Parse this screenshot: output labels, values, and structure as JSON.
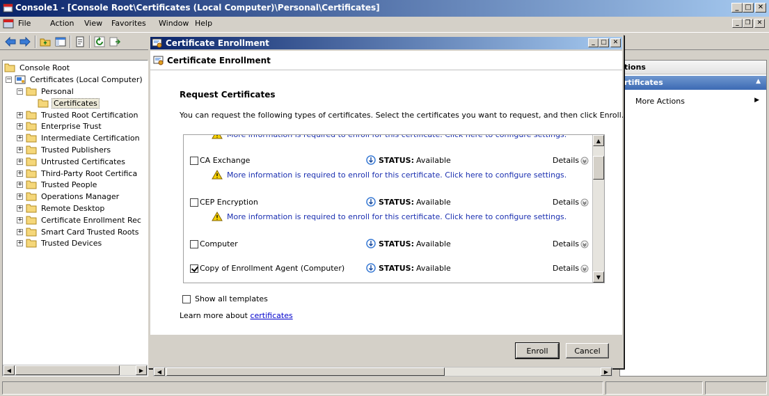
{
  "window": {
    "title": "Console1 - [Console Root\\Certificates (Local Computer)\\Personal\\Certificates]"
  },
  "menu": [
    "File",
    "Action",
    "View",
    "Favorites",
    "Window",
    "Help"
  ],
  "tree": {
    "root": "Console Root",
    "computer": "Certificates (Local Computer)",
    "personal": "Personal",
    "selected": "Certificates",
    "stores": [
      "Trusted Root Certification",
      "Enterprise Trust",
      "Intermediate Certification",
      "Trusted Publishers",
      "Untrusted Certificates",
      "Third-Party Root Certifica",
      "Trusted People",
      "Operations Manager",
      "Remote Desktop",
      "Certificate Enrollment Rec",
      "Smart Card Trusted Roots",
      "Trusted Devices"
    ]
  },
  "actions": {
    "header": "tions",
    "section": "rtificates",
    "more": "More Actions"
  },
  "dialog": {
    "title": "Certificate Enrollment",
    "header": "Certificate Enrollment",
    "heading": "Request Certificates",
    "intro": "You can request the following types of certificates. Select the certificates you want to request, and then click Enroll.",
    "status_label": "STATUS:",
    "details_label": "Details",
    "warning": "More information is required to enroll for this certificate. Click here to configure settings.",
    "certificates": [
      {
        "name": "CA Exchange",
        "status": "Available",
        "checked": false,
        "warning": true
      },
      {
        "name": "CEP Encryption",
        "status": "Available",
        "checked": false,
        "warning": true
      },
      {
        "name": "Computer",
        "status": "Available",
        "checked": false,
        "warning": false
      },
      {
        "name": "Copy of Enrollment Agent (Computer)",
        "status": "Available",
        "checked": true,
        "warning": false
      }
    ],
    "show_all": "Show all templates",
    "learn_prefix": "Learn more about ",
    "learn_link": "certificates",
    "enroll": "Enroll",
    "cancel": "Cancel"
  },
  "colors": {
    "titlebar": "#0a246a",
    "action_header": "#3c6ab4",
    "link": "#1a2fb0"
  }
}
